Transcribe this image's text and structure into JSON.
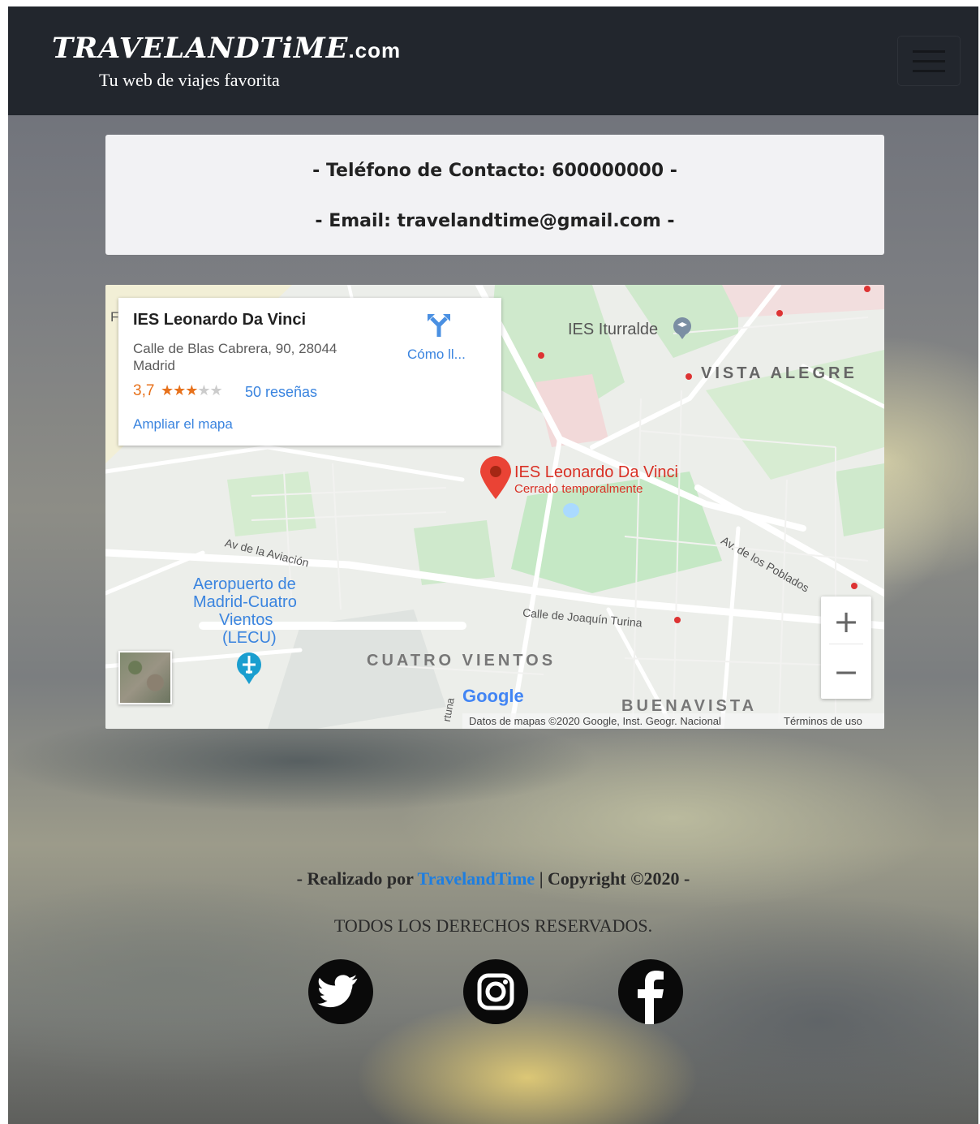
{
  "header": {
    "brand": "TRAVELANDTiME",
    "brand_suffix": ".com",
    "tagline": "Tu web de viajes favorita",
    "menu_icon": "hamburger-menu-icon",
    "colors": {
      "navbar_bg": "#22262d"
    }
  },
  "contact": {
    "phone_line": "- Teléfono de Contacto: 600000000 -",
    "email_line": "- Email: travelandtime@gmail.com -"
  },
  "map": {
    "place_name": "IES Leonardo Da Vinci",
    "address": "Calle de Blas Cabrera, 90, 28044 Madrid",
    "rating": "3,7",
    "stars": "★★★",
    "reviews": "50 reseñas",
    "enlarge_link": "Ampliar el mapa",
    "directions_label": "Cómo ll...",
    "directions_icon": "directions-icon",
    "marker_title": "IES Leonardo Da Vinci",
    "marker_subtitle": "Cerrado temporalmente",
    "labels": {
      "ies_iturralde": "IES Iturralde",
      "vista_alegre": "VISTA ALEGRE",
      "av_aviacion": "Av de la Aviación",
      "airport_1": "Aeropuerto de",
      "airport_2": "Madrid-Cuatro",
      "airport_3": "Vientos",
      "airport_4": "(LECU)",
      "cuatro_vientos": "CUATRO VIENTOS",
      "buenavista": "BUENAVISTA",
      "calle_turina": "Calle de Joaquín Turina",
      "av_poblados": "Av. de los Poblados",
      "fortuna": "rtuna",
      "edge_letter": "F"
    },
    "zoom_in": "+",
    "zoom_out": "−",
    "google_logo": "Google",
    "attribution": "Datos de mapas ©2020 Google, Inst. Geogr. Nacional",
    "terms": "Términos de uso",
    "colors": {
      "accent_link": "#3a84df",
      "rating": "#e7711b",
      "marker": "#ea4335",
      "park": "#c5e8c5"
    }
  },
  "footer": {
    "made_by_prefix": "- Realizado por ",
    "made_by_link": "TravelandTime",
    "made_by_suffix": " | Copyright ©2020 -",
    "rights": "TODOS LOS DERECHOS RESERVADOS.",
    "social": [
      {
        "name": "twitter-icon"
      },
      {
        "name": "instagram-icon"
      },
      {
        "name": "facebook-icon"
      }
    ],
    "colors": {
      "link": "#1e7ee0"
    }
  }
}
